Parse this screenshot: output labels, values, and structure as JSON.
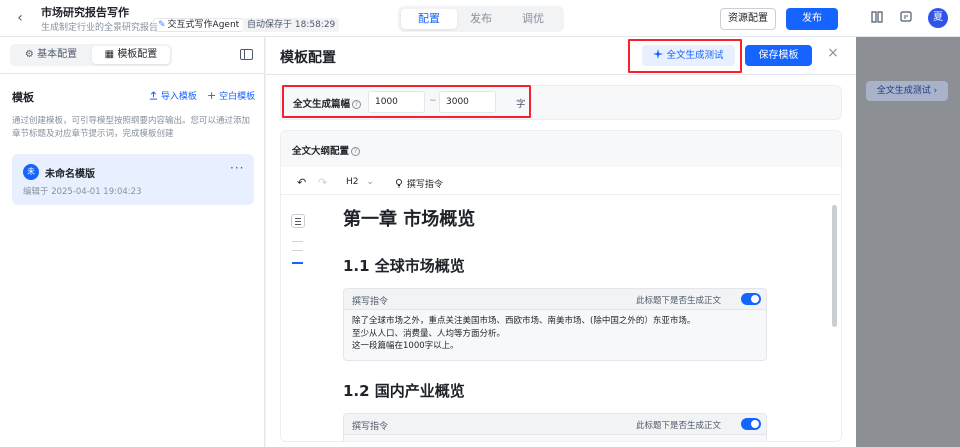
{
  "topbar": {
    "back_glyph": "‹",
    "title": "市场研究报告写作",
    "subtitle": "生成制定行业的全景研究报告",
    "agent_badge": "交互式写作Agent",
    "agent_icon": "✎",
    "autosave": "自动保存于 18:58:29",
    "tabs": [
      {
        "label": "配置",
        "active": true
      },
      {
        "label": "发布",
        "active": false
      },
      {
        "label": "调优",
        "active": false
      }
    ],
    "resource_button": "资源配置",
    "publish_button": "发布",
    "book_icon": "▯",
    "help_icon": "?",
    "avatar_text": "夏"
  },
  "left": {
    "tabs": [
      {
        "label": "基本配置",
        "icon": "⚙",
        "active": false
      },
      {
        "label": "模板配置",
        "icon": "▦",
        "active": true
      }
    ],
    "section_title": "模板",
    "import_link": "导入模板",
    "blank_link": "空白模板",
    "description": "通过创建模板，可引导模型按照纲要内容输出。您可以通过添加章节标题及对应章节提示词，完成模板创建",
    "template_card": {
      "avatar": "未",
      "name": "未命名模版",
      "edited": "编辑于 2025-04-01 19:04:23",
      "more": "···"
    }
  },
  "main": {
    "title": "模板配置",
    "test_button": "全文生成测试",
    "save_button": "保存模板",
    "close_glyph": "×",
    "length": {
      "label": "全文生成篇幅",
      "min": "1000",
      "separator": "~",
      "max": "3000",
      "unit": "字"
    },
    "outline": {
      "title": "全文大纲配置",
      "toolbar": {
        "undo": "↶",
        "redo": "↷",
        "heading": "H2",
        "heading_caret": "⌄",
        "write_instr": "撰写指令"
      },
      "h1": "第一章 市场概览",
      "sections": [
        {
          "heading": "1.1 全球市场概览",
          "instr_label": "撰写指令",
          "toggle_label": "此标题下是否生成正文",
          "body_lines": [
            "除了全球市场之外，重点关注美国市场、西欧市场、南美市场、(除中国之外的）东亚市场。",
            "至少从人口、消费量、人均等方面分析。",
            "这一段篇幅在1000字以上。"
          ]
        },
        {
          "heading": "1.2 国内产业概览",
          "instr_label": "撰写指令",
          "toggle_label": "此标题下是否生成正文"
        }
      ]
    }
  },
  "overlay": {
    "button": "全文生成测试 ›"
  },
  "colors": {
    "primary": "#1664ff",
    "highlight_red": "#f5222d"
  }
}
